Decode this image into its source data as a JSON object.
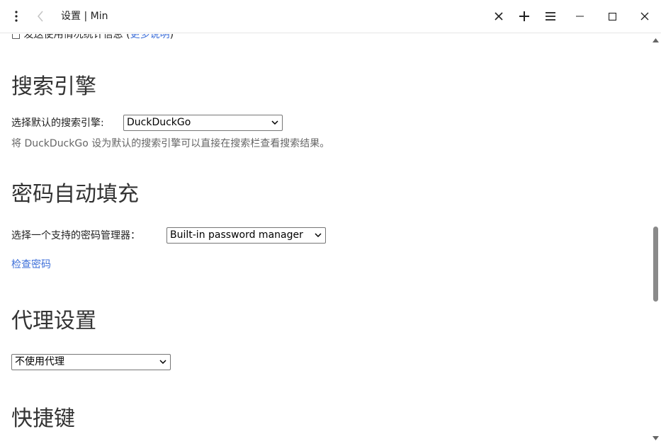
{
  "window": {
    "title": "设置 | Min"
  },
  "toolbar": {
    "menu_icon": "vertical-dots-icon",
    "back_icon": "chevron-left-icon",
    "close_tab_icon": "x-icon",
    "new_tab_icon": "plus-icon",
    "tasks_icon": "hamburger-icon",
    "minimize_icon": "minus-icon",
    "maximize_icon": "square-icon",
    "close_window_icon": "x-icon"
  },
  "partial": {
    "text": "□ 发送使用情况统计信息 (",
    "link": "更多说明",
    "tail": ")"
  },
  "search_engine": {
    "heading": "搜索引擎",
    "label": "选择默认的搜索引擎:",
    "selected": "DuckDuckGo",
    "description": "将 DuckDuckGo 设为默认的搜索引擎可以直接在搜索栏查看搜索结果。"
  },
  "password": {
    "heading": "密码自动填充",
    "label": "选择一个支持的密码管理器：",
    "selected": "Built-in password manager",
    "link": "检查密码"
  },
  "proxy": {
    "heading": "代理设置",
    "selected": "不使用代理"
  },
  "shortcuts": {
    "heading": "快捷键"
  },
  "colors": {
    "link": "#3d6fd9",
    "scroll_thumb": "#8a8a8a"
  }
}
